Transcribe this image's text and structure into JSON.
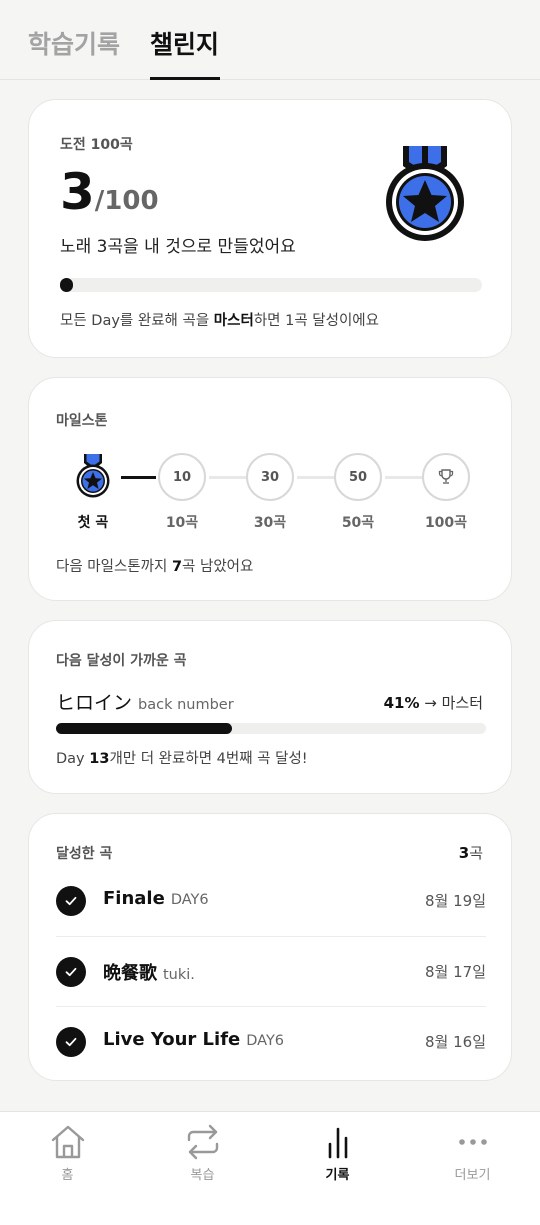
{
  "header": {
    "tabs": [
      {
        "label": "학습기록",
        "active": false
      },
      {
        "label": "챌린지",
        "active": true
      }
    ]
  },
  "challenge": {
    "title": "도전 100곡",
    "current": "3",
    "total": "/100",
    "subtitle": "노래 3곡을 내 것으로 만들었어요",
    "progress_fraction": 0.03,
    "note_prefix": "모든 Day를 완료해 곡을 ",
    "note_bold": "마스터",
    "note_suffix": "하면 1곡 달성이에요",
    "medal_icon": "medal-star-icon"
  },
  "milestone": {
    "title": "마일스톤",
    "items": [
      {
        "circle": "",
        "label": "첫 곡",
        "done": true,
        "icon": "medal-star-icon"
      },
      {
        "circle": "10",
        "label": "10곡",
        "done": false
      },
      {
        "circle": "30",
        "label": "30곡",
        "done": false
      },
      {
        "circle": "50",
        "label": "50곡",
        "done": false
      },
      {
        "circle": "",
        "label": "100곡",
        "done": false,
        "icon": "trophy-icon"
      }
    ],
    "note_prefix": "다음 마일스톤까지 ",
    "note_bold": "7",
    "note_suffix": "곡 남았어요"
  },
  "next_song": {
    "title": "다음 달성이 가까운 곡",
    "song": "ヒロイン",
    "artist": "back number",
    "percent": "41%",
    "arrow_text": " → 마스터",
    "progress_fraction": 0.41,
    "note_prefix": "Day ",
    "note_bold": "13",
    "note_suffix": "개만 더 완료하면 4번째 곡 달성!"
  },
  "achieved": {
    "title": "달성한 곡",
    "count": "3",
    "count_unit": "곡",
    "songs": [
      {
        "title": "Finale",
        "artist": "DAY6",
        "date": "8월 19일"
      },
      {
        "title": "晩餐歌",
        "artist": "tuki.",
        "date": "8월 17일"
      },
      {
        "title": "Live Your Life",
        "artist": "DAY6",
        "date": "8월 16일"
      }
    ]
  },
  "bottom_nav": [
    {
      "label": "홈",
      "icon": "home-icon",
      "active": false
    },
    {
      "label": "복습",
      "icon": "repeat-icon",
      "active": false
    },
    {
      "label": "기록",
      "icon": "bar-chart-icon",
      "active": true
    },
    {
      "label": "더보기",
      "icon": "more-icon",
      "active": false
    }
  ],
  "colors": {
    "accent_blue": "#3366e6",
    "background": "#f5f5f3",
    "primary": "#111111"
  }
}
